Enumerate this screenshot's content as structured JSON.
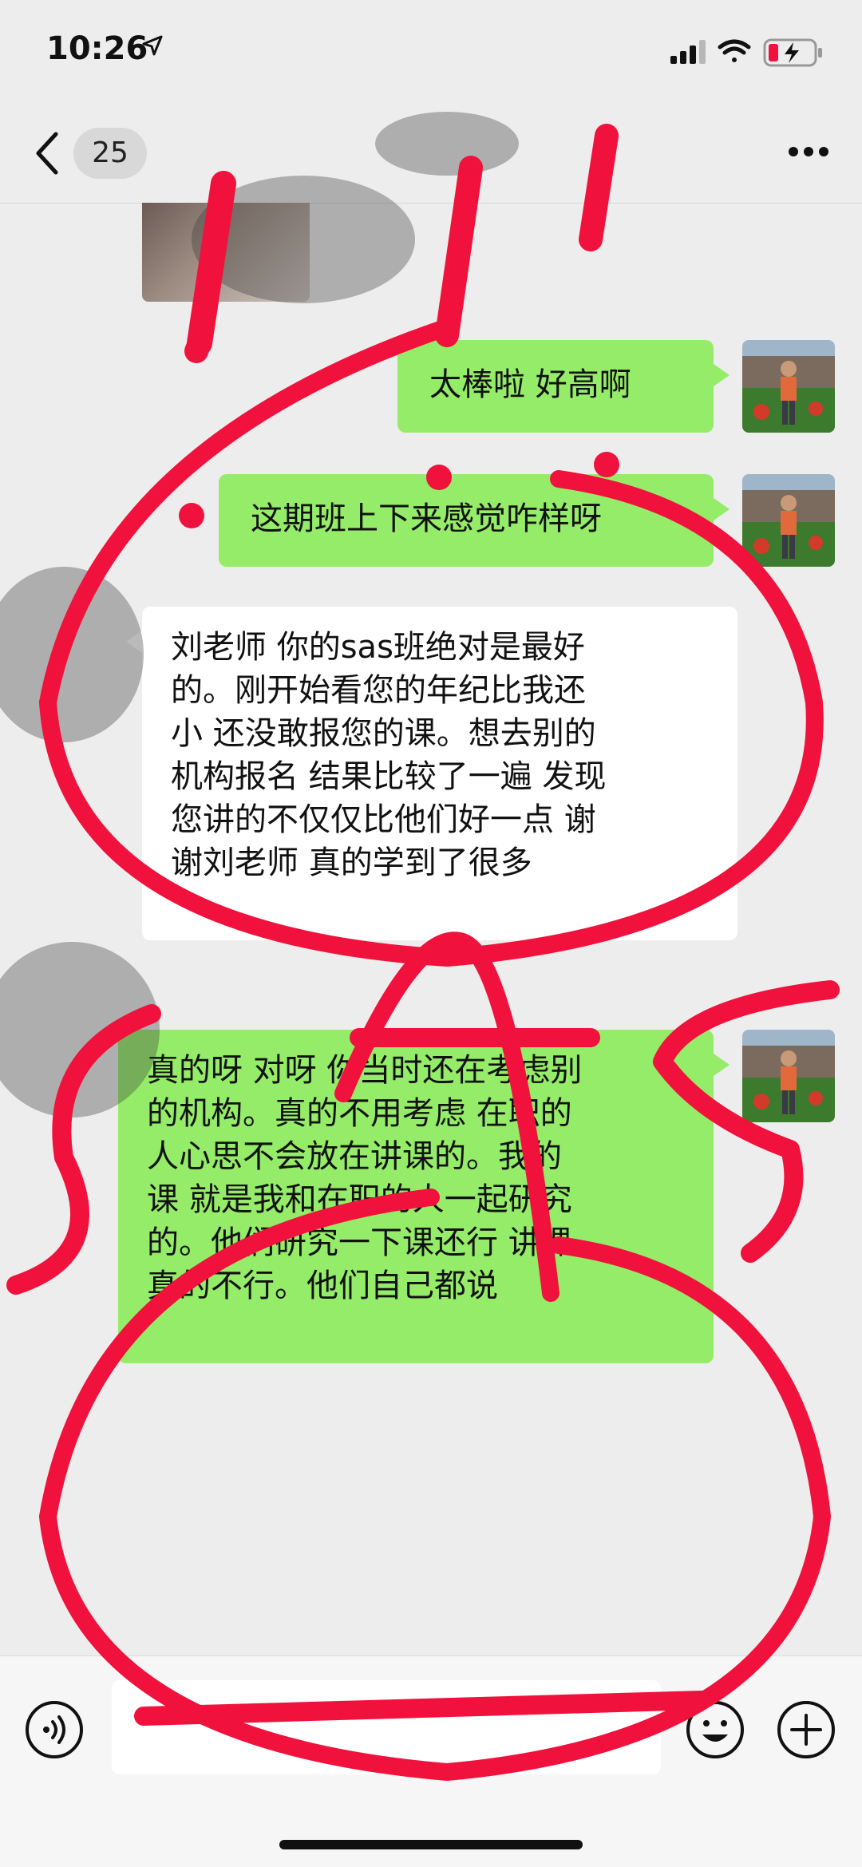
{
  "status_bar": {
    "time": "10:26"
  },
  "nav": {
    "unread_count": "25"
  },
  "messages": [
    {
      "side": "me",
      "text": "太棒啦 好高啊"
    },
    {
      "side": "me",
      "text": "这期班上下来感觉咋样呀"
    },
    {
      "side": "other",
      "lines": [
        "刘老师 你的sas班绝对是最好",
        "的。刚开始看您的年纪比我还",
        "小 还没敢报您的课。想去别的",
        "机构报名 结果比较了一遍 发现",
        "您讲的不仅仅比他们好一点 谢",
        "谢刘老师 真的学到了很多"
      ]
    },
    {
      "side": "me",
      "lines": [
        "真的呀 对呀 你当时还在考虑别",
        "的机构。真的不用考虑 在职的",
        "人心思不会放在讲课的。我的",
        "课 就是我和在职的人一起研究",
        "的。他们研究一下课还行 讲课",
        "真的不行。他们自己都说"
      ]
    }
  ],
  "input": {
    "placeholder": ""
  },
  "colors": {
    "my_bubble": "#95ec69",
    "other_bubble": "#ffffff",
    "annotation": "#f0123c"
  },
  "icons": [
    "location-arrow-icon",
    "signal-icon",
    "wifi-icon",
    "battery-icon",
    "back-chevron-icon",
    "more-icon",
    "voice-icon",
    "emoji-icon",
    "plus-icon"
  ]
}
